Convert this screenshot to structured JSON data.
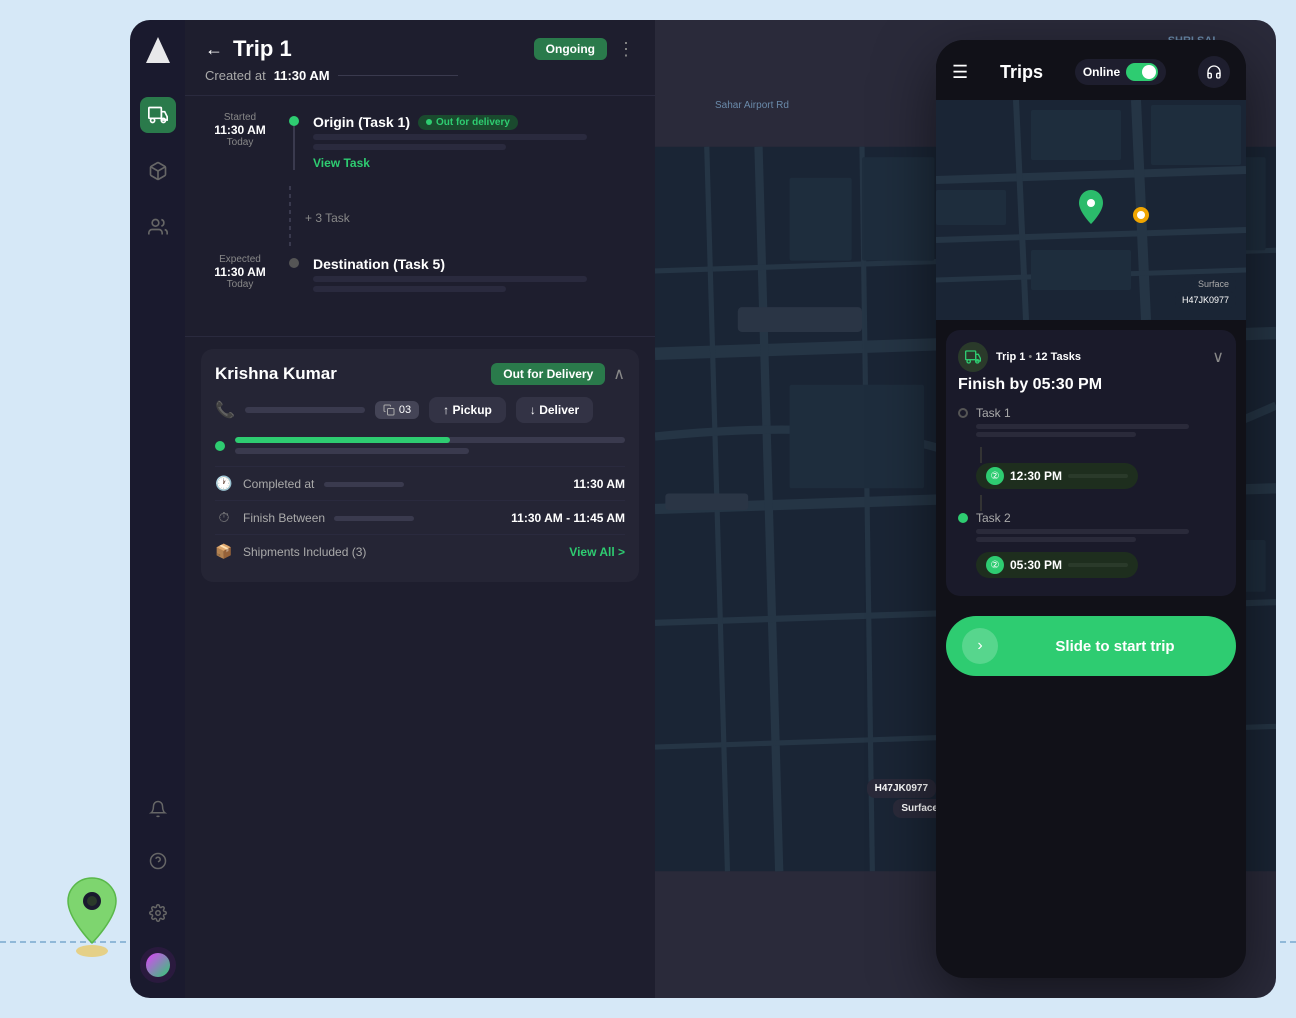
{
  "app": {
    "title": "Trip 1",
    "back_label": "←",
    "status": "Ongoing",
    "created_label": "Created at",
    "created_time": "11:30 AM",
    "more_icon": "⋮"
  },
  "sidebar": {
    "icons": [
      {
        "name": "logo",
        "symbol": "▲"
      },
      {
        "name": "truck",
        "symbol": "🚚",
        "active": true
      },
      {
        "name": "box",
        "symbol": "📦"
      },
      {
        "name": "team",
        "symbol": "👥"
      }
    ],
    "bottom_icons": [
      {
        "name": "bell",
        "symbol": "🔔"
      },
      {
        "name": "help",
        "symbol": "?"
      },
      {
        "name": "settings",
        "symbol": "⚙"
      },
      {
        "name": "avatar",
        "symbol": "🎨"
      }
    ]
  },
  "timeline": {
    "origin": {
      "label": "Started",
      "time": "11:30 AM",
      "sub": "Today",
      "task": "Origin (Task 1)",
      "badge": "Out for delivery"
    },
    "middle": {
      "label": "+ 3 Task"
    },
    "destination": {
      "label": "Expected",
      "time": "11:30 AM",
      "sub": "Today",
      "task": "Destination (Task 5)"
    },
    "view_task": "View Task"
  },
  "driver": {
    "name": "Krishna Kumar",
    "status": "Out for Delivery",
    "task_count": "03",
    "actions": {
      "pickup": "↑ Pickup",
      "deliver": "↓ Deliver"
    },
    "info": {
      "completed_label": "Completed at",
      "completed_value": "11:30 AM",
      "finish_label": "Finish Between",
      "finish_value": "11:30 AM - 11:45 AM",
      "shipments_label": "Shipments Included (3)",
      "view_all": "View All >"
    }
  },
  "mobile": {
    "title": "Trips",
    "online_label": "Online",
    "trip_label": "Trip 1",
    "tasks_count": "12 Tasks",
    "finish_by": "Finish by 05:30 PM",
    "task1_label": "Task 1",
    "time1": "12:30 PM",
    "task2_label": "Task 2",
    "time2": "05:30 PM",
    "slide_label": "Slide to start trip"
  },
  "map": {
    "chip1": "H47JK0977",
    "chip2": "Surface"
  },
  "colors": {
    "green": "#2ecc71",
    "dark_bg": "#1e1e2e",
    "card_bg": "#252535",
    "accent": "#2a7a4b"
  }
}
